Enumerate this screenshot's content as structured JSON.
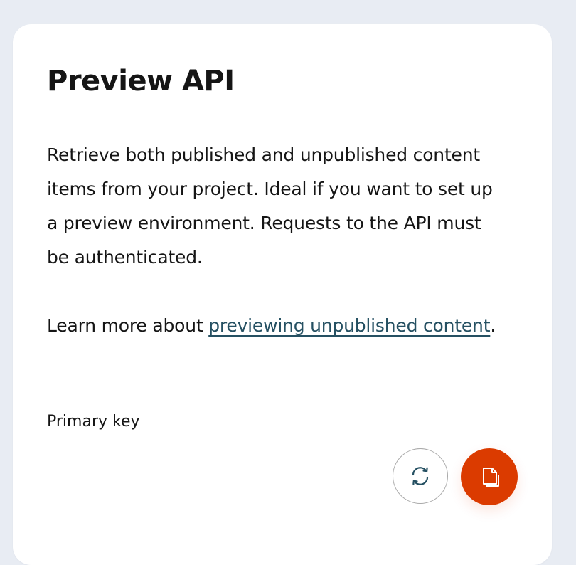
{
  "card": {
    "title": "Preview API",
    "description": "Retrieve both published and unpublished content items from your project. Ideal if you want to set up a preview environment. Requests to the API must be authenticated.",
    "learn_more_prefix": "Learn more about ",
    "learn_more_link": "previewing unpublished content",
    "learn_more_suffix": ".",
    "primary_key_label": "Primary key"
  },
  "actions": {
    "regenerate_icon": "sync-icon",
    "copy_icon": "copy-icon"
  },
  "colors": {
    "page_background": "#e8ecf3",
    "card_background": "#ffffff",
    "link": "#255062",
    "accent": "#db3b00",
    "text": "#151515"
  }
}
